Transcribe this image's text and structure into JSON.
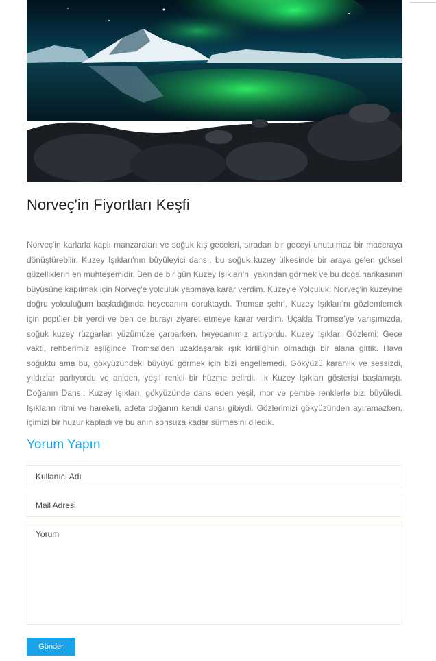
{
  "article": {
    "title": "Norveç'in Fiyortları Keşfi",
    "body": "Norveç'in karlarla kaplı manzaraları ve soğuk kış geceleri, sıradan bir geceyi unutulmaz bir maceraya dönüştürebilir. Kuzey Işıkları'nın büyüleyici dansı, bu soğuk kuzey ülkesinde bir araya gelen göksel güzelliklerin en muhteşemidir. Ben de bir gün Kuzey Işıkları'nı yakından görmek ve bu doğa harikasının büyüsüne kapılmak için Norveç'e yolculuk yapmaya karar verdim. Kuzey'e Yolculuk: Norveç'in kuzeyine doğru yolculuğum başladığında heyecanım doruktaydı. Tromsø şehri, Kuzey Işıkları'nı gözlemlemek için popüler bir yerdi ve ben de burayı ziyaret etmeye karar verdim. Uçakla Tromsø'ye varışımızda, soğuk kuzey rüzgarları yüzümüze çarparken, heyecanımız artıyordu. Kuzey Işıkları Gözlemi: Gece vakti, rehberimiz eşliğinde Tromsø'den uzaklaşarak ışık kirliliğinin olmadığı bir alana gittik. Hava soğuktu ama bu, gökyüzündeki büyüyü görmek için bizi engellemedi. Gökyüzü karanlık ve sessizdi, yıldızlar parlıyordu ve aniden, yeşil renkli bir hüzme belirdi. İlk Kuzey Işıkları gösterisi başlamıştı. Doğanın Dansı: Kuzey Işıkları, gökyüzünde dans eden yeşil, mor ve pembe renklerle bizi büyüledi. Işıkların ritmi ve hareketi, adeta doğanın kendi dansı gibiydi. Gözlerimizi gökyüzünden ayıramazken, içimizi bir huzur kapladı ve bu anın sonsuza kadar sürmesini diledik."
  },
  "comment_form": {
    "heading": "Yorum Yapın",
    "username_placeholder": "Kullanıcı Adı",
    "email_placeholder": "Mail Adresi",
    "comment_placeholder": "Yorum",
    "submit_label": "Gönder"
  },
  "colors": {
    "accent": "#1aa3e8",
    "body_text": "#7a7a7a",
    "title_text": "#222222",
    "field_border": "#f0ead8"
  }
}
